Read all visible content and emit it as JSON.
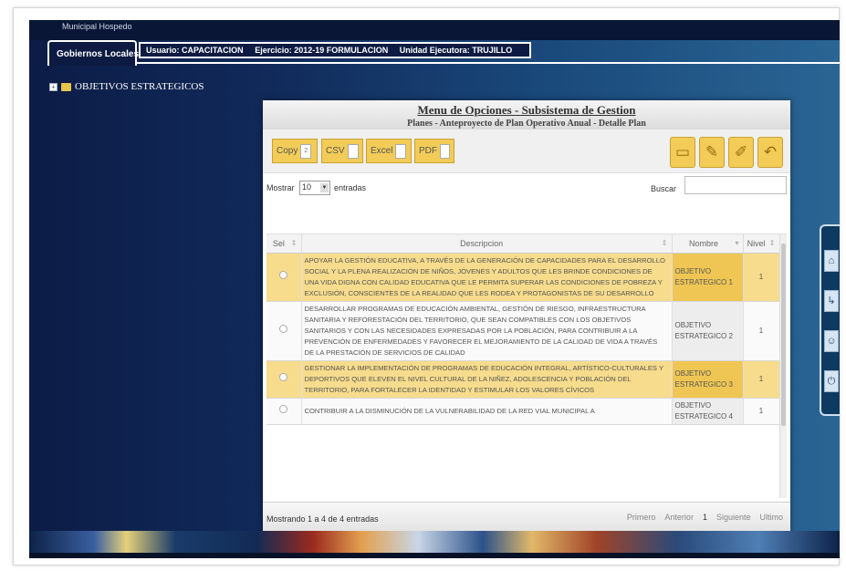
{
  "app": {
    "title": "Municipal Hospedo"
  },
  "tabs": {
    "active_label": "Gobiernos Locales"
  },
  "infobar": {
    "user": "Usuario: CAPACITACION",
    "exercise": "Ejercicio: 2012-19 FORMULACION",
    "unit": "Unidad Ejecutora: TRUJILLO"
  },
  "tree": {
    "expand_glyph": "+",
    "node_label": "OBJETIVOS ESTRATEGICOS"
  },
  "dialog": {
    "title": "Menu de Opciones - Subsistema de Gestion",
    "subtitle": "Planes - Anteproyecto de Plan Operativo Anual - Detalle Plan"
  },
  "toolbar": {
    "copy_label": "Copy",
    "copy_count": "2",
    "csv_label": "CSV",
    "excel_label": "Excel",
    "pdf_label": "PDF",
    "actions": [
      {
        "name": "new-icon",
        "glyph": "▭"
      },
      {
        "name": "edit-icon",
        "glyph": "✎"
      },
      {
        "name": "pencil-icon",
        "glyph": "✐"
      },
      {
        "name": "undo-icon",
        "glyph": "↶"
      }
    ]
  },
  "controls": {
    "show_label": "Mostrar",
    "page_length": "10",
    "entries_label": "entradas",
    "search_label": "Buscar",
    "search_value": ""
  },
  "table": {
    "headers": {
      "sel": "Sel",
      "descripcion": "Descripcion",
      "nombre": "Nombre",
      "nivel": "Nivel"
    },
    "rows": [
      {
        "descripcion": "APOYAR LA GESTIÓN EDUCATIVA, A TRAVÉS DE LA GENERACIÓN DE CAPACIDADES PARA EL DESARROLLO SOCIAL Y LA PLENA REALIZACIÓN DE NIÑOS, JÓVENES Y ADULTOS QUE LES BRINDE CONDICIONES DE UNA VIDA DIGNA CON CALIDAD EDUCATIVA QUE LE PERMITA SUPERAR LAS CONDICIONES DE POBREZA Y EXCLUSIÓN, CONSCIENTES DE LA REALIDAD QUE LES RODEA Y PROTAGONISTAS DE SU DESARROLLO",
        "nombre": "OBJETIVO ESTRATEGICO 1",
        "nivel": "1"
      },
      {
        "descripcion": "DESARROLLAR PROGRAMAS DE EDUCACIÓN AMBIENTAL, GESTIÓN DE RIESGO, INFRAESTRUCTURA SANITARIA Y REFORESTACIÓN DEL TERRITORIO, QUE SEAN COMPATIBLES CON LOS OBJETIVOS SANITARIOS Y CON LAS NECESIDADES EXPRESADAS POR LA POBLACIÓN, PARA CONTRIBUIR A LA PREVENCIÓN DE ENFERMEDADES Y FAVORECER EL MEJORAMIENTO DE LA CALIDAD DE VIDA A TRAVÉS DE LA PRESTACIÓN DE SERVICIOS DE CALIDAD",
        "nombre": "OBJETIVO ESTRATEGICO 2",
        "nivel": "1"
      },
      {
        "descripcion": "GESTIONAR LA IMPLEMENTACIÓN DE PROGRAMAS DE EDUCACIÓN INTEGRAL, ARTÍSTICO-CULTURALES Y DEPORTIVOS QUE ELEVEN EL NIVEL CULTURAL DE LA NIÑEZ, ADOLESCENCIA Y POBLACIÓN DEL TERRITORIO, PARA FORTALECER LA IDENTIDAD Y ESTIMULAR LOS VALORES CÍVICOS",
        "nombre": "OBJETIVO ESTRATEGICO 3",
        "nivel": "1"
      },
      {
        "descripcion": "CONTRIBUIR A LA DISMINUCIÓN DE LA VULNERABILIDAD DE LA RED VIAL MUNICIPAL A",
        "nombre": "OBJETIVO ESTRATEGICO 4",
        "nivel": "1"
      }
    ]
  },
  "footer": {
    "info": "Mostrando 1 a 4 de 4 entradas",
    "first": "Primero",
    "previous": "Anterior",
    "current_page": "1",
    "next": "Siguiente",
    "last": "Ultimo"
  },
  "side_panel": [
    {
      "name": "home-icon",
      "glyph": "⌂"
    },
    {
      "name": "exit-icon",
      "glyph": "↳"
    },
    {
      "name": "user-icon",
      "glyph": "☺"
    },
    {
      "name": "power-icon",
      "glyph": "⏻"
    }
  ]
}
